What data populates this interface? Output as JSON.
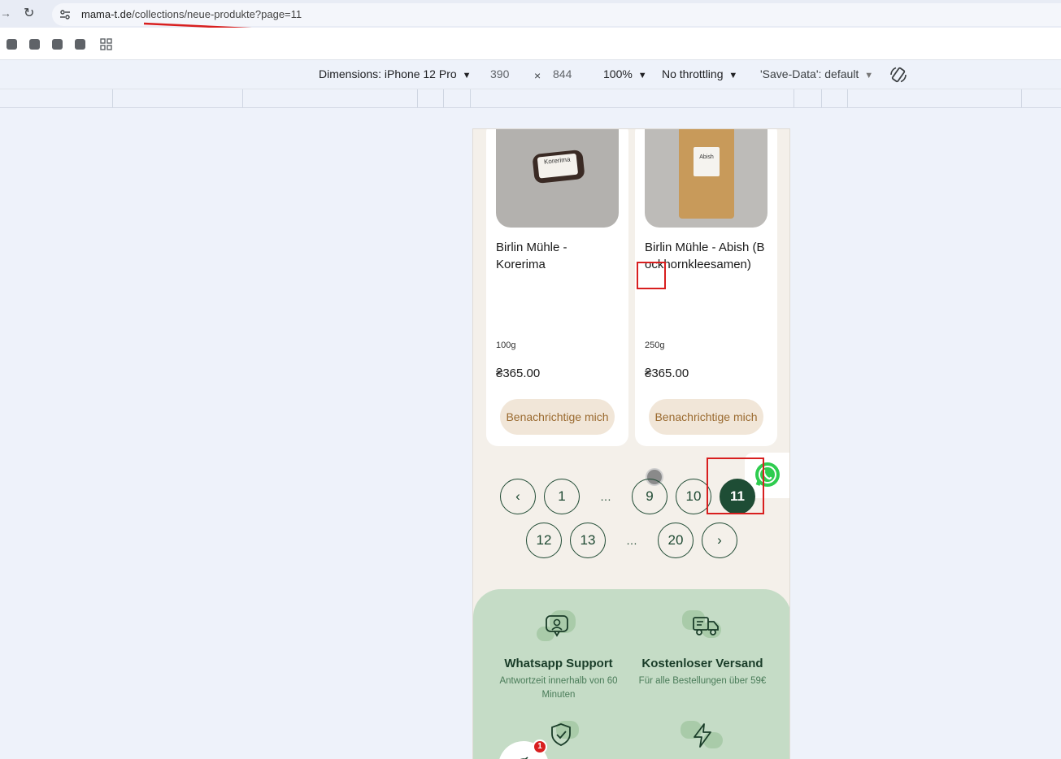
{
  "browser": {
    "url_host": "mama-t.de",
    "url_path": "/collections/neue-produkte?page=11"
  },
  "devtools": {
    "dimensions_label": "Dimensions: iPhone 12 Pro",
    "width": "390",
    "times": "×",
    "height": "844",
    "zoom": "100%",
    "throttling": "No throttling",
    "save_data": "'Save-Data': default"
  },
  "products": [
    {
      "name": "Birlin Mühle - Korerima",
      "weight": "100g",
      "price": "₴365.00",
      "button": "Benachrichtige mich",
      "image_label": "Korerima"
    },
    {
      "name": "Birlin Mühle - Abish (Bockhornkleesamen)",
      "weight": "250g",
      "price": "₴365.00",
      "button": "Benachrichtige mich",
      "image_label": "Abish"
    }
  ],
  "pagination": {
    "row1": [
      "1",
      "…",
      "9",
      "10",
      "11"
    ],
    "row2": [
      "12",
      "13",
      "…",
      "20"
    ],
    "prev": "‹",
    "next": "›",
    "current": "11"
  },
  "features": [
    {
      "title": "Whatsapp Support",
      "subtitle": "Antwortzeit innerhalb von 60 Minuten"
    },
    {
      "title": "Kostenloser Versand",
      "subtitle": "Für alle Bestellungen über 59€"
    }
  ],
  "cart_badge": "1",
  "colors": {
    "brand_green": "#1e4d35",
    "button_bg": "#f1e6d8",
    "feature_bg": "#c5dcc6",
    "annotation_red": "#d81f1f"
  }
}
